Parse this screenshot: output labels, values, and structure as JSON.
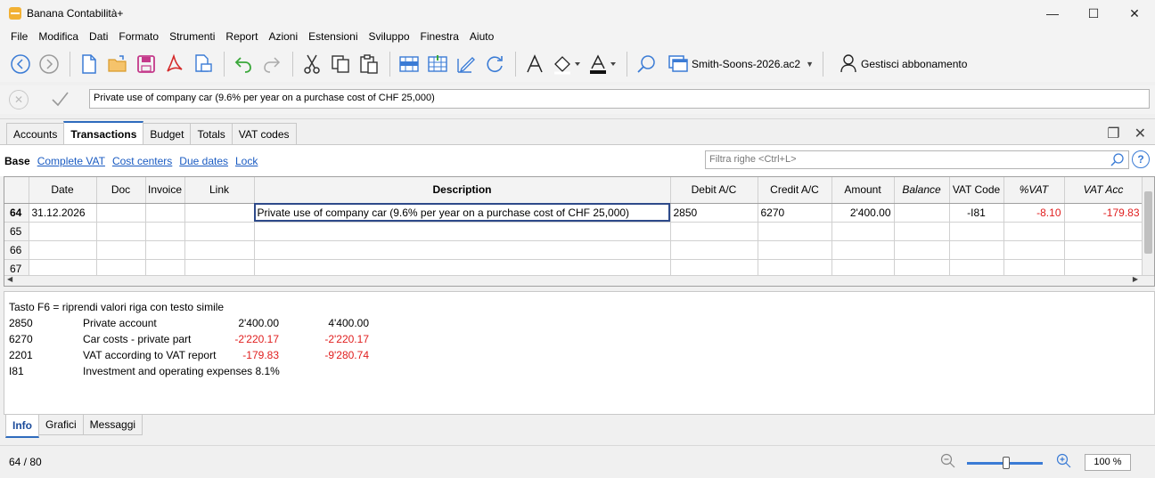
{
  "window": {
    "title": "Banana Contabilità+",
    "controls": {
      "minimize": "—",
      "maximize": "☐",
      "close": "✕"
    }
  },
  "menu": [
    "File",
    "Modifica",
    "Dati",
    "Formato",
    "Strumenti",
    "Report",
    "Azioni",
    "Estensioni",
    "Sviluppo",
    "Finestra",
    "Aiuto"
  ],
  "toolbar": {
    "file_name": "Smith-Soons-2026.ac2",
    "subscription_label": "Gestisci abbonamento",
    "icons": [
      "back-icon",
      "forward-icon",
      "new-file-icon",
      "open-folder-icon",
      "save-icon",
      "pdf-icon",
      "print-preview-icon",
      "undo-icon",
      "redo-icon",
      "cut-icon",
      "copy-icon",
      "paste-icon",
      "insert-row-icon",
      "add-rows-icon",
      "edit-icon",
      "refresh-icon",
      "font-icon",
      "fill-color-icon",
      "text-color-icon",
      "search-icon",
      "window-icon",
      "user-icon"
    ]
  },
  "edit_bar": {
    "value": "Private use of company car (9.6% per year on a purchase cost of CHF 25,000)"
  },
  "tabs": [
    "Accounts",
    "Transactions",
    "Budget",
    "Totals",
    "VAT codes"
  ],
  "active_tab": "Transactions",
  "views": {
    "base": "Base",
    "links": [
      "Complete VAT",
      "Cost centers",
      "Due dates",
      "Lock"
    ]
  },
  "filter": {
    "placeholder": "Filtra righe <Ctrl+L>"
  },
  "grid": {
    "columns": [
      "",
      "Date",
      "Doc",
      "Invoice",
      "Link",
      "Description",
      "Debit A/C",
      "Credit A/C",
      "Amount",
      "Balance",
      "VAT Code",
      "%VAT",
      "VAT Acc"
    ],
    "rows": [
      {
        "num": "64",
        "date": "31.12.2026",
        "doc": "",
        "invoice": "",
        "link": "",
        "description": "Private use of company car (9.6% per year on a purchase cost of CHF 25,000)",
        "debit": "2850",
        "credit": "6270",
        "amount": "2'400.00",
        "balance": "",
        "vat_code": "-I81",
        "pct_vat": "-8.10",
        "vat_acc": "-179.83"
      },
      {
        "num": "65",
        "date": "",
        "doc": "",
        "invoice": "",
        "link": "",
        "description": "",
        "debit": "",
        "credit": "",
        "amount": "",
        "balance": "",
        "vat_code": "",
        "pct_vat": "",
        "vat_acc": ""
      },
      {
        "num": "66",
        "date": "",
        "doc": "",
        "invoice": "",
        "link": "",
        "description": "",
        "debit": "",
        "credit": "",
        "amount": "",
        "balance": "",
        "vat_code": "",
        "pct_vat": "",
        "vat_acc": ""
      },
      {
        "num": "67",
        "date": "",
        "doc": "",
        "invoice": "",
        "link": "",
        "description": "",
        "debit": "",
        "credit": "",
        "amount": "",
        "balance": "",
        "vat_code": "",
        "pct_vat": "",
        "vat_acc": ""
      }
    ]
  },
  "info": {
    "hint": "Tasto F6 = riprendi valori riga con testo simile",
    "lines": [
      {
        "account": "2850",
        "name": "Private account",
        "amount": "2'400.00",
        "balance": "4'400.00"
      },
      {
        "account": "6270",
        "name": "Car costs - private part",
        "amount": "-2'220.17",
        "balance": "-2'220.17"
      },
      {
        "account": "2201",
        "name": "VAT according to VAT report",
        "amount": "-179.83",
        "balance": "-9'280.74"
      },
      {
        "account": "I81",
        "name": "Investment and operating expenses 8.1%",
        "amount": "",
        "balance": ""
      }
    ]
  },
  "bottom_tabs": [
    "Info",
    "Grafici",
    "Messaggi"
  ],
  "status": {
    "row_position": "64 / 80",
    "zoom": "100 %"
  },
  "colors": {
    "accent": "#2e6bbd",
    "negative": "#e01e1e",
    "link": "#1a5bc2"
  }
}
